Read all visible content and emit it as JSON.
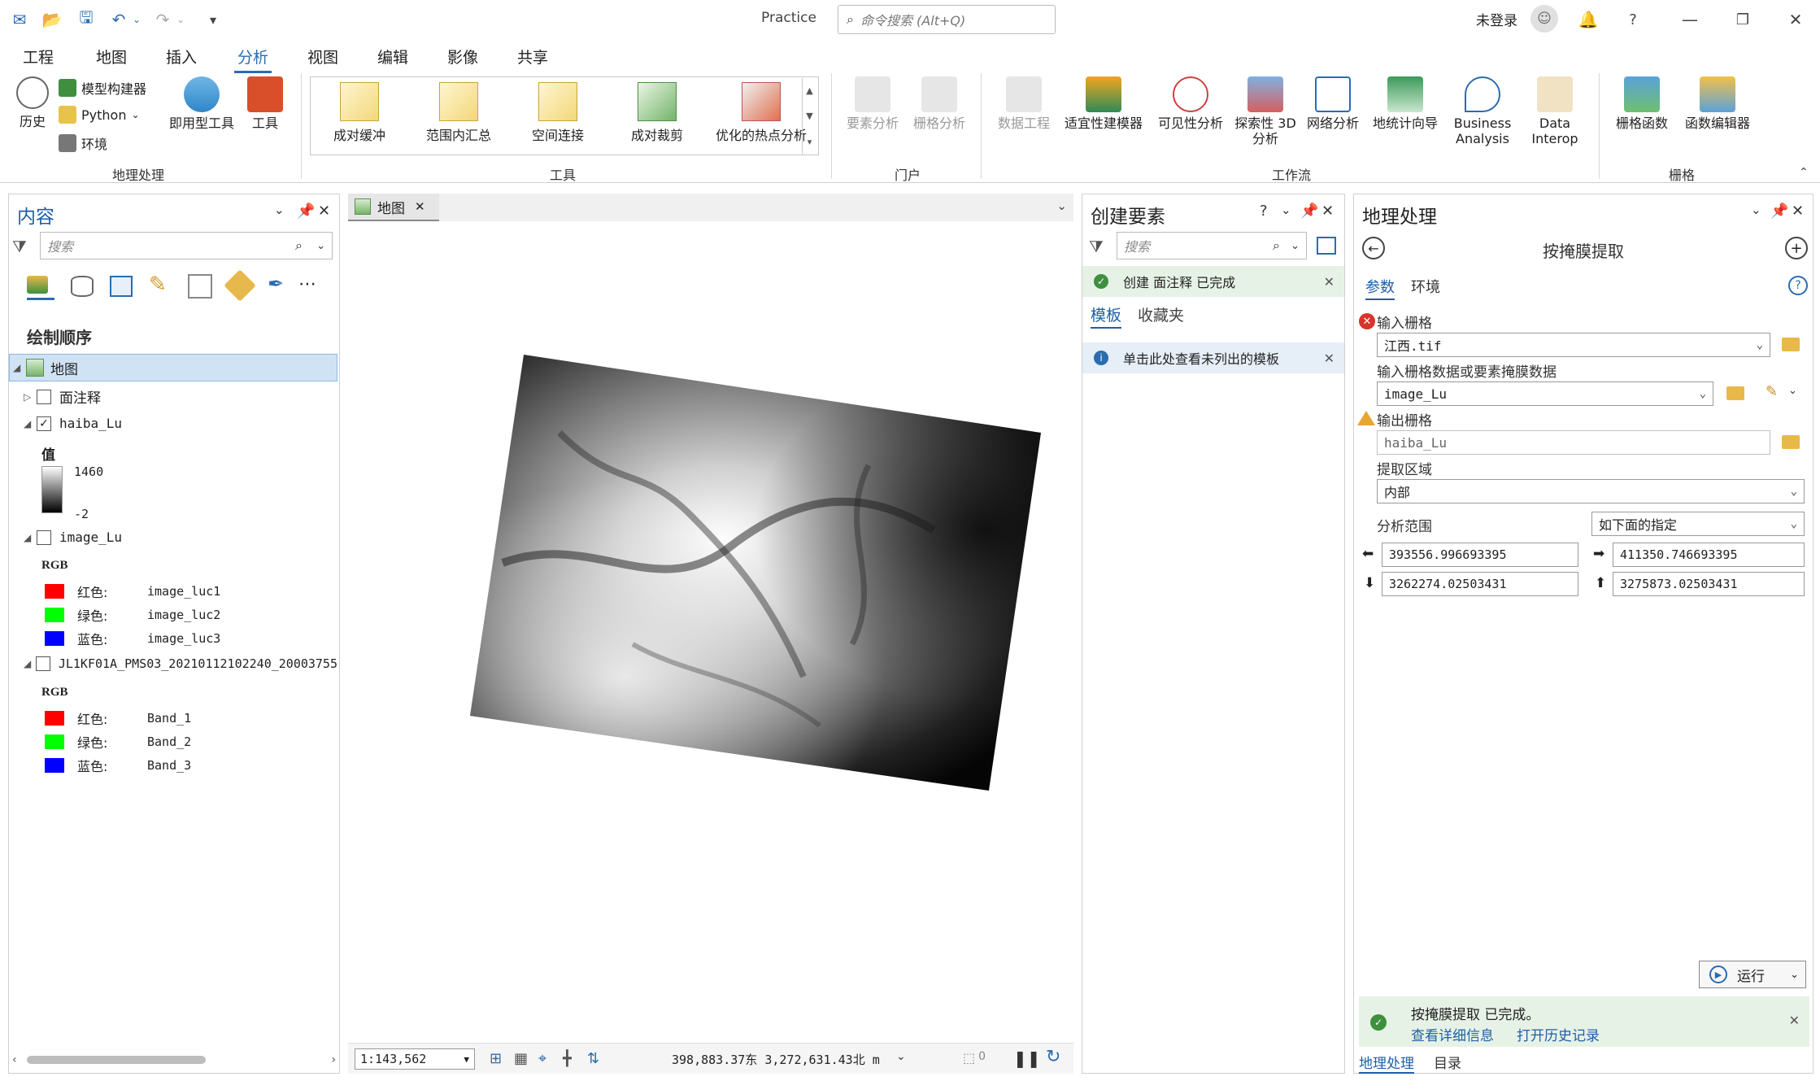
{
  "title_bar": {
    "doc_title": "Practice",
    "search_placeholder": "命令搜索 (Alt+Q)",
    "login": "未登录"
  },
  "menu": {
    "tabs": [
      "工程",
      "地图",
      "插入",
      "分析",
      "视图",
      "编辑",
      "影像",
      "共享"
    ],
    "active": "分析"
  },
  "ribbon": {
    "geoprocessing": {
      "label": "地理处理",
      "history": "历史",
      "model_builder": "模型构建器",
      "python": "Python",
      "environment": "环境",
      "ready_tools": "即用型工具",
      "tools": "工具"
    },
    "tools_group": {
      "label": "工具",
      "items": [
        "成对缓冲",
        "范围内汇总",
        "空间连接",
        "成对裁剪",
        "优化的热点分析"
      ]
    },
    "portal": {
      "label": "门户",
      "feature_analysis": "要素分析",
      "raster_analysis": "栅格分析"
    },
    "workflow": {
      "label": "工作流",
      "data_engineering": "数据工程",
      "suitability": "适宜性建模器",
      "visibility": "可见性分析",
      "explore_3d": "探索性 3D 分析",
      "network": "网络分析",
      "geostat": "地统计向导",
      "business": "Business Analysis",
      "data_interop": "Data Interop"
    },
    "raster": {
      "label": "栅格",
      "raster_functions": "栅格函数",
      "function_editor": "函数编辑器"
    }
  },
  "contents": {
    "title": "内容",
    "search_placeholder": "搜索",
    "drawing_order": "绘制顺序",
    "map_name": "地图",
    "layers": [
      {
        "name": "面注释",
        "checked": false
      },
      {
        "name": "haiba_Lu",
        "checked": true,
        "value_label": "值",
        "max": "1460",
        "min": "-2"
      },
      {
        "name": "image_Lu",
        "checked": false,
        "mode": "RGB",
        "bands": [
          {
            "label": "红色:",
            "name": "image_luc1",
            "color": "#ff0000"
          },
          {
            "label": "绿色:",
            "name": "image_luc2",
            "color": "#00ff00"
          },
          {
            "label": "蓝色:",
            "name": "image_luc3",
            "color": "#0000ff"
          }
        ]
      },
      {
        "name": "JL1KF01A_PMS03_20210112102240_20003755",
        "checked": false,
        "mode": "RGB",
        "bands": [
          {
            "label": "红色:",
            "name": "Band_1",
            "color": "#ff0000"
          },
          {
            "label": "绿色:",
            "name": "Band_2",
            "color": "#00ff00"
          },
          {
            "label": "蓝色:",
            "name": "Band_3",
            "color": "#0000ff"
          }
        ]
      }
    ]
  },
  "map_view": {
    "tab_label": "地图",
    "scale": "1:143,562",
    "coords": "398,883.37东  3,272,631.43北 m",
    "selected_count": "0"
  },
  "create_features": {
    "title": "创建要素",
    "search_placeholder": "搜索",
    "status": "创建  面注释  已完成",
    "tabs": [
      "模板",
      "收藏夹"
    ],
    "info": "单击此处查看未列出的模板"
  },
  "geoprocessing": {
    "title": "地理处理",
    "tool_name": "按掩膜提取",
    "tabs": [
      "参数",
      "环境"
    ],
    "input_raster_label": "输入栅格",
    "input_raster_value": "江西.tif",
    "mask_label": "输入栅格数据或要素掩膜数据",
    "mask_value": "image_Lu",
    "output_label": "输出栅格",
    "output_value": "haiba_Lu",
    "extract_area_label": "提取区域",
    "extract_area_value": "内部",
    "extent_label": "分析范围",
    "extent_value": "如下面的指定",
    "left": "393556.996693395",
    "right": "411350.746693395",
    "bottom": "3262274.02503431",
    "top": "3275873.02503431",
    "run": "运行",
    "result_line1": "按掩膜提取  已完成。",
    "result_details": "查看详细信息",
    "result_history": "打开历史记录",
    "bottom_tabs": [
      "地理处理",
      "目录"
    ]
  },
  "colors": {
    "accent": "#2b6cb0",
    "success_bg": "#e7f2e6",
    "info_bg": "#e6eef8"
  }
}
